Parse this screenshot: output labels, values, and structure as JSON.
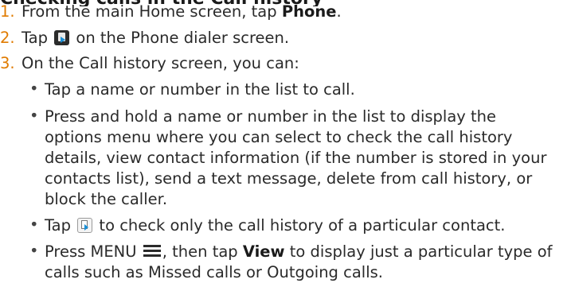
{
  "heading_partial": "Checking calls in the Call history",
  "steps": [
    {
      "num": "1.",
      "pre": "From the main Home screen, tap ",
      "bold": "Phone",
      "post": "."
    },
    {
      "num": "2.",
      "pre": "Tap ",
      "icon": "call-history-icon",
      "post": " on the Phone dialer screen."
    },
    {
      "num": "3.",
      "text": "On the Call history screen, you can:"
    }
  ],
  "bullets": {
    "b1": "Tap a name or number in the list to call.",
    "b2": "Press and hold a name or number in the list to display the options menu where you can select to check the call history details, view contact information (if the number is stored in your contacts list), send a text message, delete from call history, or block the caller.",
    "b3_pre": "Tap ",
    "b3_icon": "contact-call-history-icon",
    "b3_post": " to check only the call history of a particular contact.",
    "b4_pre": "Press MENU ",
    "b4_icon": "menu-icon",
    "b4_mid": ", then tap ",
    "b4_bold": "View",
    "b4_post": " to display just a particular type of calls such as Missed calls or Outgoing calls."
  },
  "bullet_glyph": "•",
  "colors": {
    "step_number": "#e07b00",
    "text": "#2a2a2a"
  }
}
